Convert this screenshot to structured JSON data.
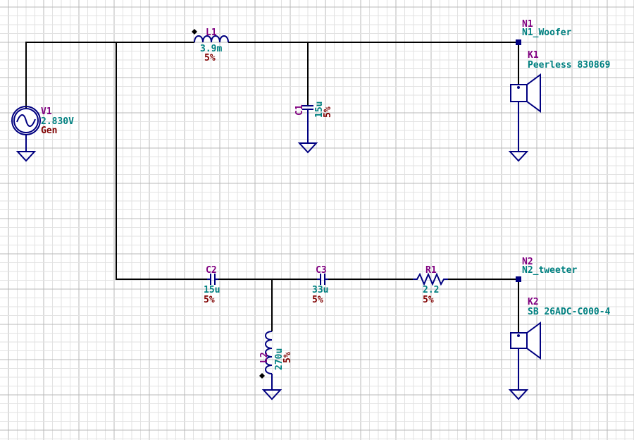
{
  "grid": {
    "minor_color": "#e2e2e2",
    "major_color": "#b8b8b8"
  },
  "colors": {
    "wire": "#000000",
    "symbol": "#000080",
    "ref": "#800080",
    "value": "#008080",
    "tolerance": "#800000",
    "node": "#000080"
  },
  "components": {
    "V1": {
      "ref": "V1",
      "value": "2.830V",
      "extra": "Gen"
    },
    "L1": {
      "ref": "L1",
      "value": "3.9m",
      "tolerance": "5%"
    },
    "C1": {
      "ref": "C1",
      "value": "15u",
      "tolerance": "5%"
    },
    "K1": {
      "ref": "K1",
      "value": "Peerless 830869"
    },
    "C2": {
      "ref": "C2",
      "value": "15u",
      "tolerance": "5%"
    },
    "C3": {
      "ref": "C3",
      "value": "33u",
      "tolerance": "5%"
    },
    "R1": {
      "ref": "R1",
      "value": "2.2",
      "tolerance": "5%"
    },
    "L2": {
      "ref": "L2",
      "value": "270u",
      "tolerance": "5%"
    },
    "K2": {
      "ref": "K2",
      "value": "SB 26ADC-C000-4"
    }
  },
  "nodes": {
    "N1": {
      "ref": "N1",
      "name": "N1_Woofer"
    },
    "N2": {
      "ref": "N2",
      "name": "N2_tweeter"
    }
  },
  "icons": [
    "ac-source-icon",
    "inductor-icon",
    "capacitor-icon",
    "resistor-icon",
    "speaker-icon",
    "ground-icon"
  ]
}
